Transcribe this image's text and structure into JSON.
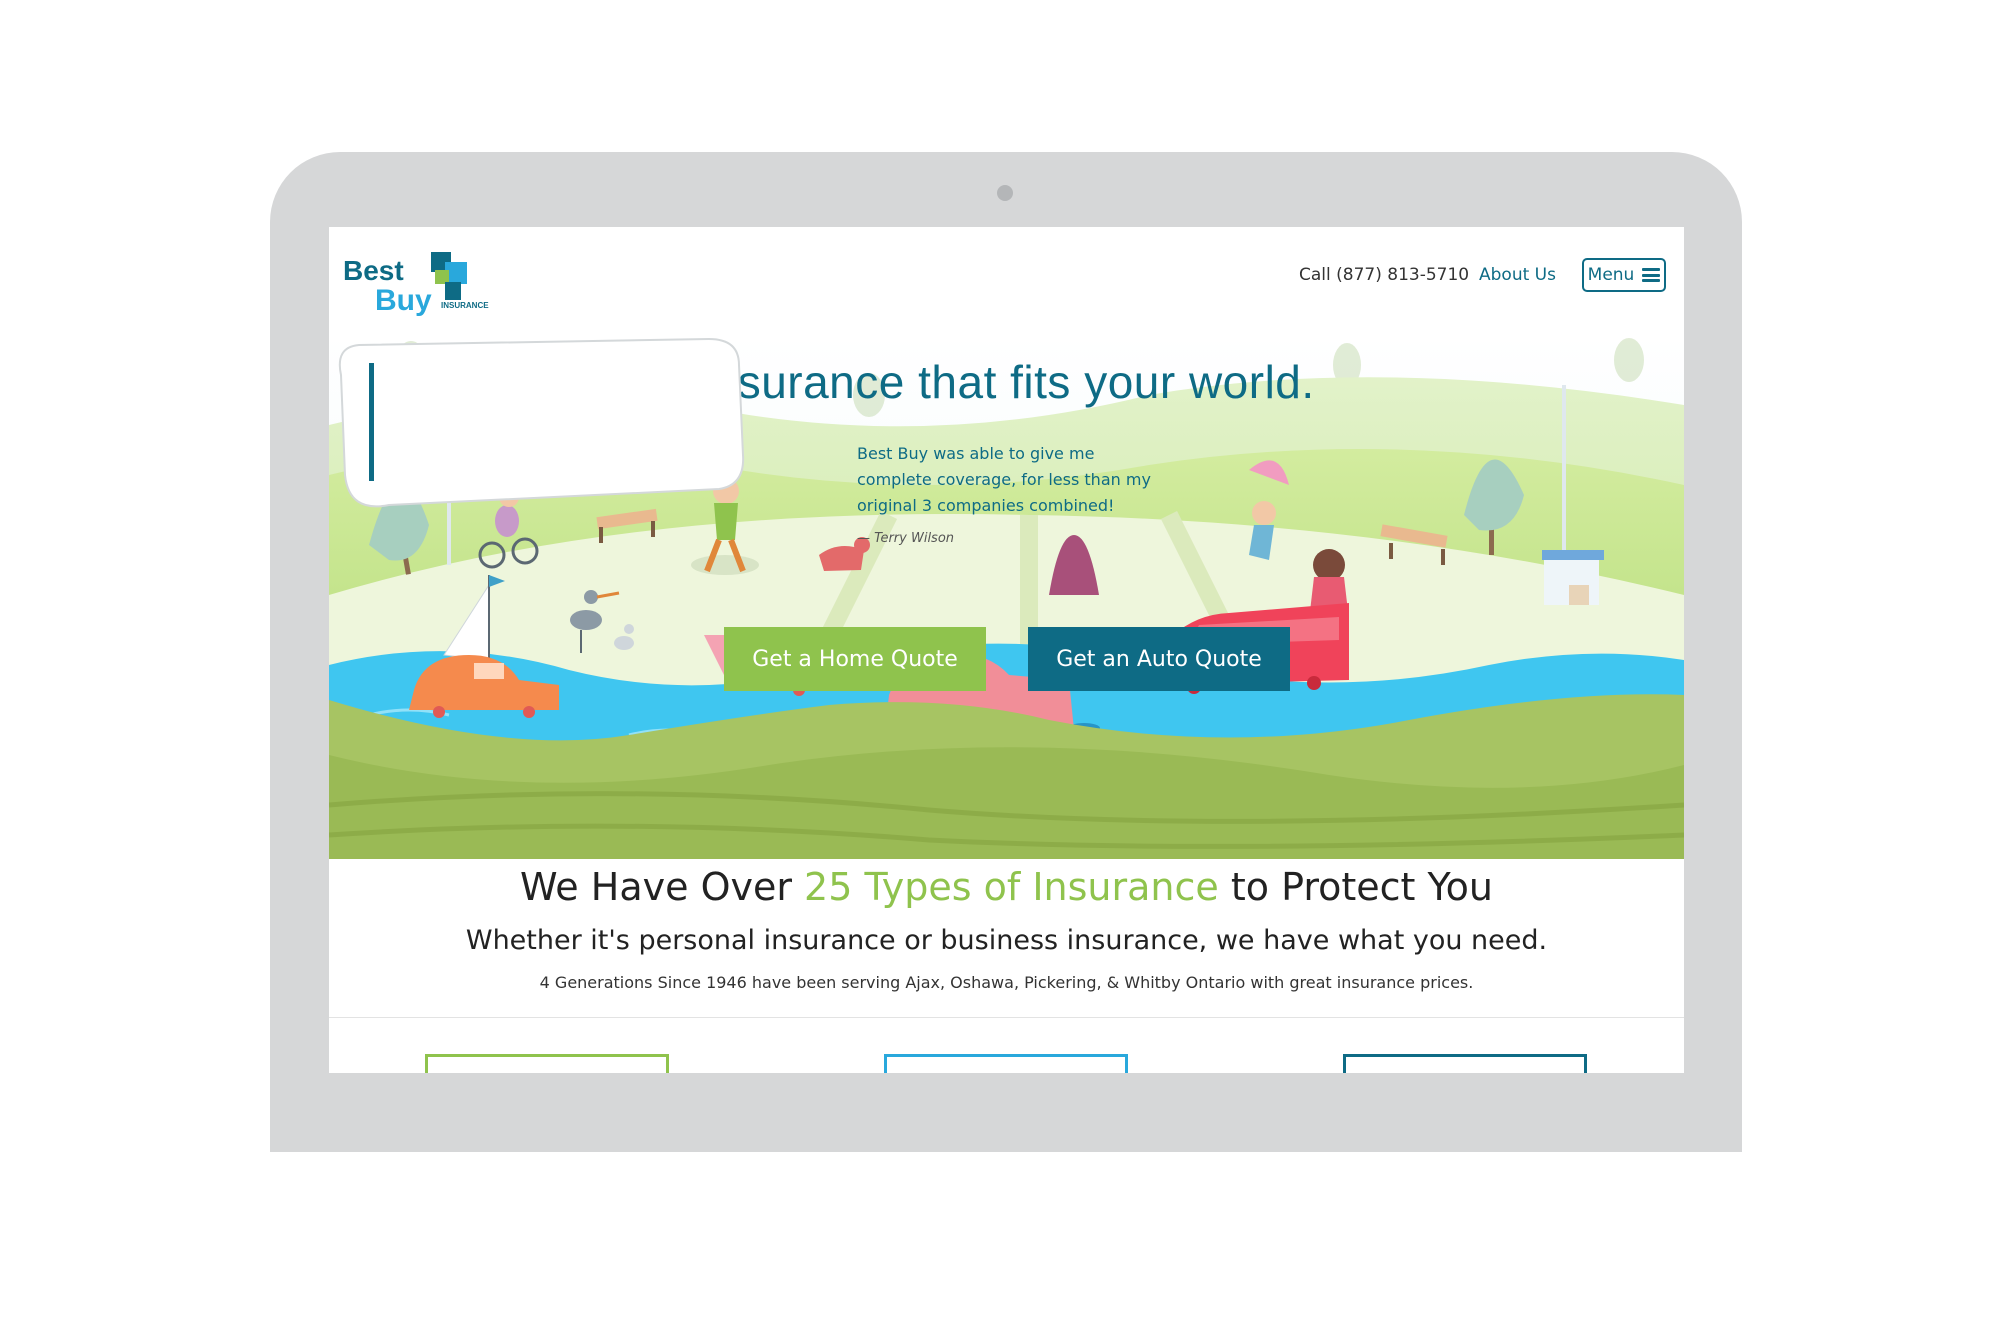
{
  "colors": {
    "brand_teal": "#0e6b85",
    "brand_green": "#8fc34d",
    "brand_blue": "#29a8dc",
    "laptop_gray": "#d6d7d8"
  },
  "header": {
    "logo": {
      "word1": "Best",
      "word2": "Buy",
      "tagline": "INSURANCE"
    },
    "call_label": "Call (877) 813-5710",
    "about_label": "About Us",
    "menu_label": "Menu",
    "menu_icon": "hamburger-icon"
  },
  "hero": {
    "title": "Insurance that fits your world.",
    "testimonial": {
      "quote": "Best Buy was able to give me complete coverage, for less than my original 3 companies combined!",
      "author": "— Terry Wilson"
    },
    "home_quote_label": "Get a Home Quote",
    "auto_quote_label": "Get an Auto Quote"
  },
  "content": {
    "heading_pre": "We Have Over ",
    "heading_highlight": "25 Types of Insurance",
    "heading_post": " to Protect You",
    "subheading": "Whether it's personal insurance or business insurance, we have what you need.",
    "tagline": "4 Generations Since 1946 have been serving Ajax, Oshawa, Pickering, & Whitby Ontario with great insurance prices."
  }
}
